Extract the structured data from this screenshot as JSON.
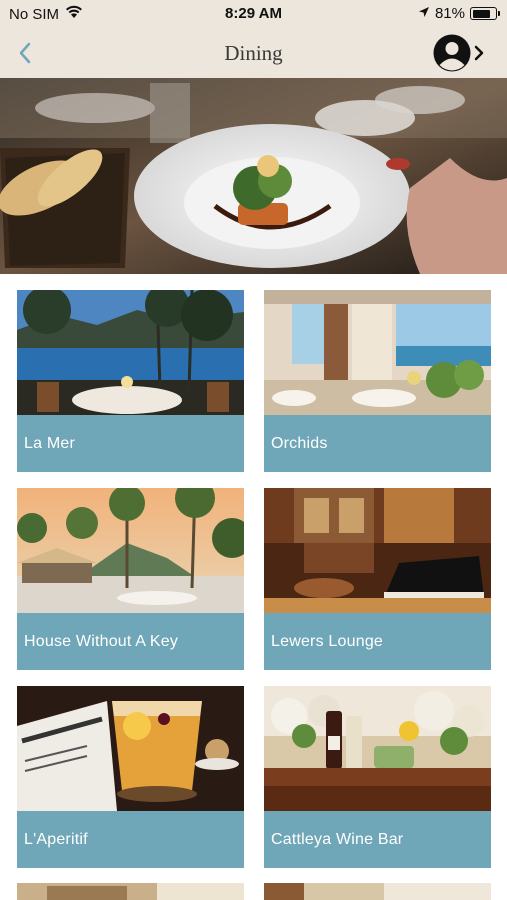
{
  "status_bar": {
    "carrier": "No SIM",
    "time": "8:29 AM",
    "battery": "81%",
    "battery_level": 0.81
  },
  "nav": {
    "title": "Dining"
  },
  "restaurants": [
    {
      "name": "La Mer"
    },
    {
      "name": "Orchids"
    },
    {
      "name": "House Without A Key"
    },
    {
      "name": "Lewers Lounge"
    },
    {
      "name": "L'Aperitif"
    },
    {
      "name": "Cattleya Wine Bar"
    }
  ],
  "colors": {
    "card_label_bg": "#6fa6b8",
    "header_bg": "#ece6dc",
    "back_arrow": "#6fa6b8"
  }
}
